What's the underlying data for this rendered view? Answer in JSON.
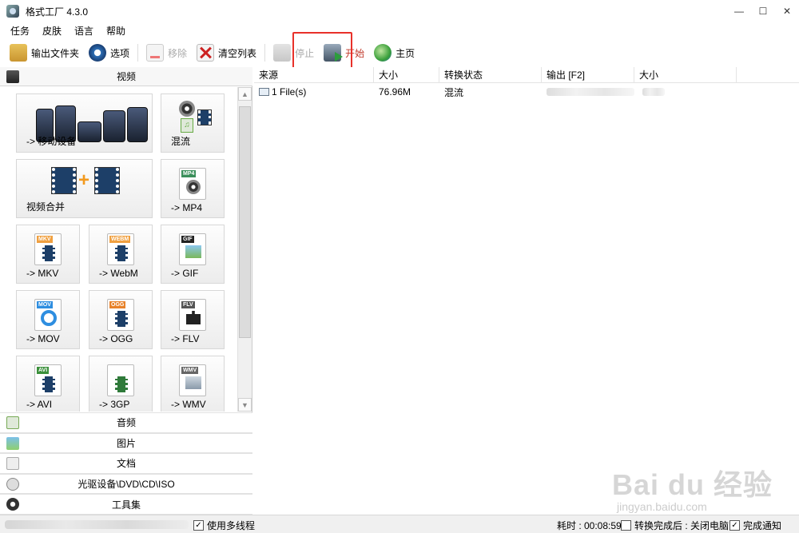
{
  "window": {
    "title": "格式工厂 4.3.0",
    "min_glyph": "—",
    "max_glyph": "☐",
    "close_glyph": "✕"
  },
  "menu": [
    "任务",
    "皮肤",
    "语言",
    "帮助"
  ],
  "toolbar": {
    "output_folder": "输出文件夹",
    "options": "选项",
    "remove": "移除",
    "clear_list": "清空列表",
    "stop": "停止",
    "start": "开始",
    "home": "主页"
  },
  "categories": {
    "video": "视频",
    "audio": "音频",
    "image": "图片",
    "document": "文档",
    "disc": "光驱设备\\DVD\\CD\\ISO",
    "tools": "工具集"
  },
  "video_tiles": {
    "mobile": "-> 移动设备",
    "mux": "混流",
    "merge": "视频合并",
    "mp4": "-> MP4",
    "mkv": "-> MKV",
    "webm": "-> WebM",
    "gif": "-> GIF",
    "mov": "-> MOV",
    "ogg": "-> OGG",
    "flv": "-> FLV",
    "avi": "-> AVI",
    "3gp": "-> 3GP",
    "wmv": "-> WMV"
  },
  "tile_badges": {
    "mp4": "MP4",
    "gif": "GIF",
    "mov": "MOV",
    "ogg": "OGG",
    "flv": "FLV",
    "avi": "AVI",
    "wmv": "WMV",
    "mkv": "MKV",
    "webm": "WEBM"
  },
  "colors": {
    "highlight": "#e8312a",
    "start_label": "#c0392b"
  },
  "filelist": {
    "columns": [
      "来源",
      "大小",
      "转换状态",
      "输出 [F2]",
      "大小"
    ],
    "rows": [
      {
        "source": "1 File(s)",
        "size": "76.96M",
        "status": "混流",
        "output": "",
        "out_size": ""
      }
    ]
  },
  "statusbar": {
    "multithread": "使用多线程",
    "elapsed": "耗时 : 00:08:59",
    "after_convert": "转换完成后 : 关闭电脑",
    "notify": "完成通知",
    "check_glyph": "✓"
  },
  "watermark": {
    "logo": "Bai du 经验",
    "url": "jingyan.baidu.com"
  }
}
